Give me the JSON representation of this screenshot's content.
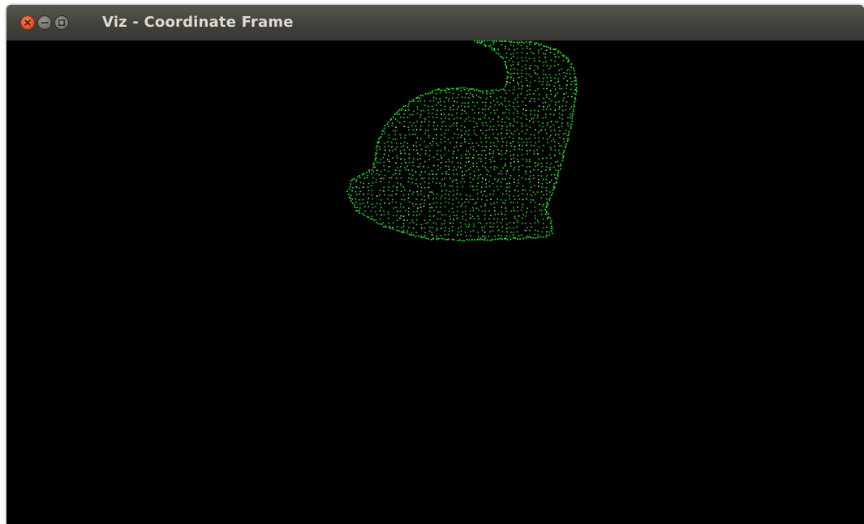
{
  "window": {
    "title": "Viz - Coordinate Frame",
    "controls": [
      "close",
      "minimize",
      "maximize"
    ]
  },
  "viewport": {
    "background_color": "#000000",
    "cloud_color": "#22dd22",
    "cloud_highlight_color": "#8cff8c"
  },
  "colors": {
    "titlebar": "#403f3a",
    "title_text": "#dfdbd2",
    "close_button": "#e0502a"
  }
}
